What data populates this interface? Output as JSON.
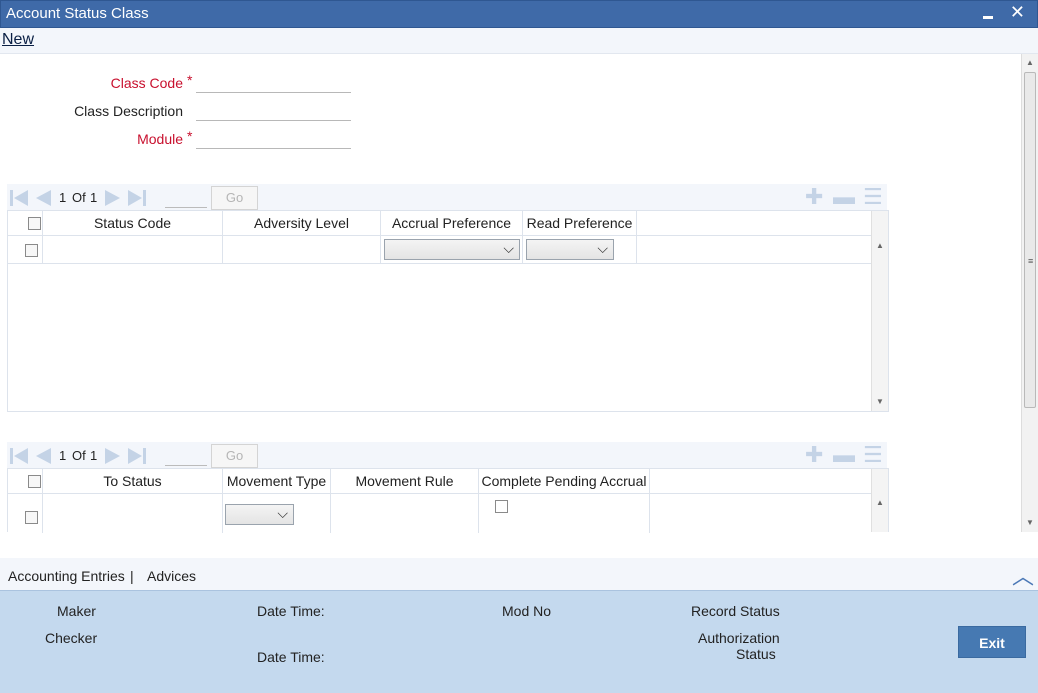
{
  "window": {
    "title": "Account Status Class"
  },
  "menu": {
    "new_label": "New"
  },
  "form": {
    "class_code_label": "Class Code",
    "class_desc_label": "Class Description",
    "module_label": "Module",
    "required_marker": "*",
    "class_code_value": "",
    "class_desc_value": "",
    "module_value": ""
  },
  "grid1": {
    "page": "1",
    "of_label": "Of",
    "total": "1",
    "go_label": "Go",
    "columns": [
      "Status Code",
      "Adversity Level",
      "Accrual Preference",
      "Read Preference"
    ]
  },
  "grid2": {
    "page": "1",
    "of_label": "Of",
    "total": "1",
    "go_label": "Go",
    "columns": [
      "To Status",
      "Movement Type",
      "Movement Rule",
      "Complete Pending Accrual"
    ]
  },
  "tabs": {
    "accounting_entries": "Accounting Entries",
    "separator": "|",
    "advices": "Advices"
  },
  "audit": {
    "maker": "Maker",
    "checker": "Checker",
    "date_time_1": "Date Time:",
    "date_time_2": "Date Time:",
    "mod_no": "Mod No",
    "record_status": "Record Status",
    "authorization": "Authorization",
    "status": "Status",
    "exit_label": "Exit"
  },
  "colors": {
    "titlebar": "#3f6aa8",
    "required": "#c8102e",
    "footer": "#c4d9ee",
    "exit_button": "#4679b2"
  }
}
